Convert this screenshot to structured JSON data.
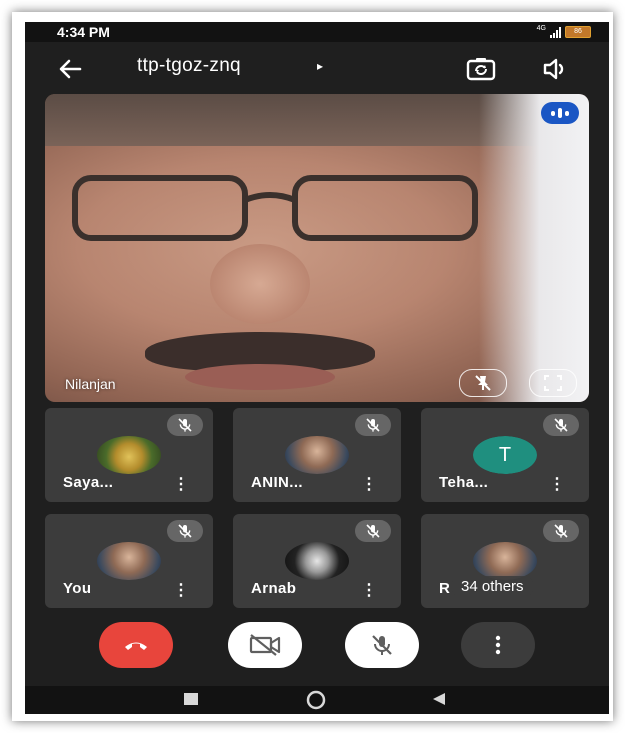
{
  "status_bar": {
    "time": "4:34 PM",
    "network": "4G",
    "battery": "86"
  },
  "header": {
    "meeting_code": "ttp-tgoz-znq",
    "caret": "▸"
  },
  "main_video": {
    "participant_name": "Nilanjan"
  },
  "participants": [
    {
      "name": "Saya...",
      "muted": true,
      "avatar": "peacock-photo"
    },
    {
      "name": "ANIN...",
      "muted": true,
      "avatar": "person-photo"
    },
    {
      "name": "Teha...",
      "muted": true,
      "avatar": "letter",
      "initial": "T",
      "color": "#1f8f7f"
    },
    {
      "name": "You",
      "muted": true,
      "avatar": "person-photo"
    },
    {
      "name": "Arnab",
      "muted": true,
      "avatar": "logo-photo"
    },
    {
      "name": "R",
      "muted": true,
      "avatar": "person-photo",
      "others_label": "34 others"
    }
  ],
  "controls": {
    "end_call_color": "#e8453c",
    "button_light_color": "#ffffff",
    "button_dark_color": "#3c3c3c"
  },
  "icons": [
    "back-arrow-icon",
    "camera-switch-icon",
    "speaker-icon",
    "mic-off-icon",
    "pin-off-icon",
    "fullscreen-icon",
    "more-vert-icon",
    "end-call-icon",
    "video-off-icon",
    "nav-square-icon",
    "nav-circle-icon",
    "nav-triangle-icon"
  ]
}
